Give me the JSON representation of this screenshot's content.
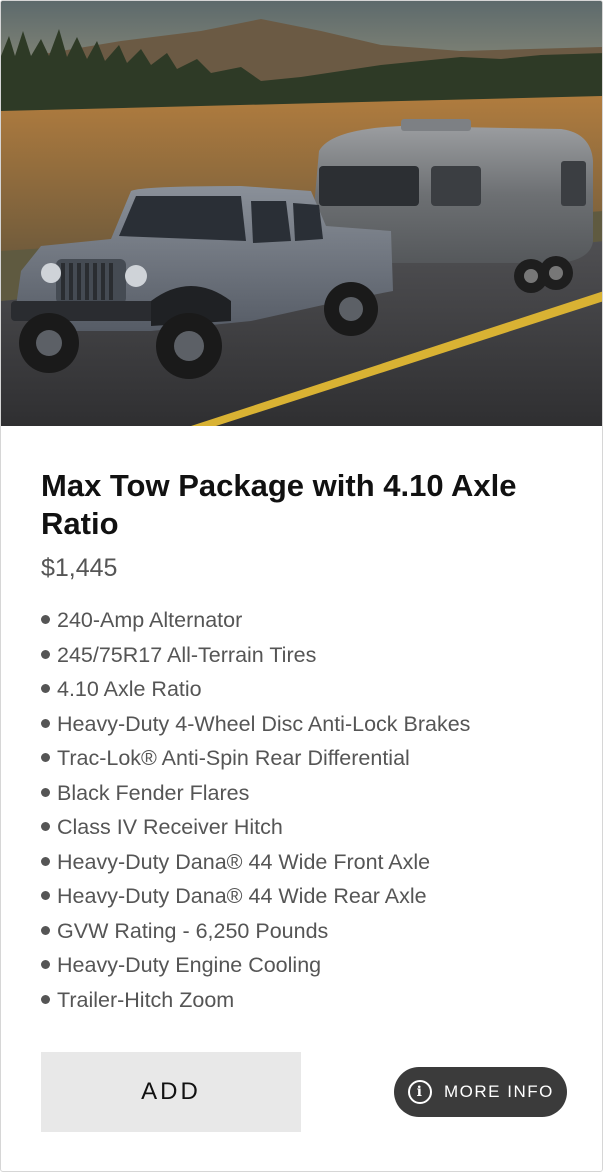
{
  "package": {
    "image_alt": "Jeep Gladiator towing an Airstream trailer",
    "title": "Max Tow Package with 4.10 Axle Ratio",
    "price": "$1,445",
    "features": [
      "240-Amp Alternator",
      "245/75R17 All-Terrain Tires",
      "4.10 Axle Ratio",
      "Heavy-Duty 4-Wheel Disc Anti-Lock Brakes",
      "Trac-Lok® Anti-Spin Rear Differential",
      "Black Fender Flares",
      "Class IV Receiver Hitch",
      "Heavy-Duty Dana® 44 Wide Front Axle",
      "Heavy-Duty Dana® 44 Wide Rear Axle",
      "GVW Rating - 6,250 Pounds",
      "Heavy-Duty Engine Cooling",
      "Trailer-Hitch Zoom"
    ]
  },
  "actions": {
    "add_label": "ADD",
    "more_info_label": "MORE INFO",
    "more_info_icon": "info-circle-icon"
  },
  "colors": {
    "title": "#111111",
    "body_text": "#555555",
    "add_button_bg": "#e8e8e8",
    "more_info_bg": "#3b3b3b"
  }
}
